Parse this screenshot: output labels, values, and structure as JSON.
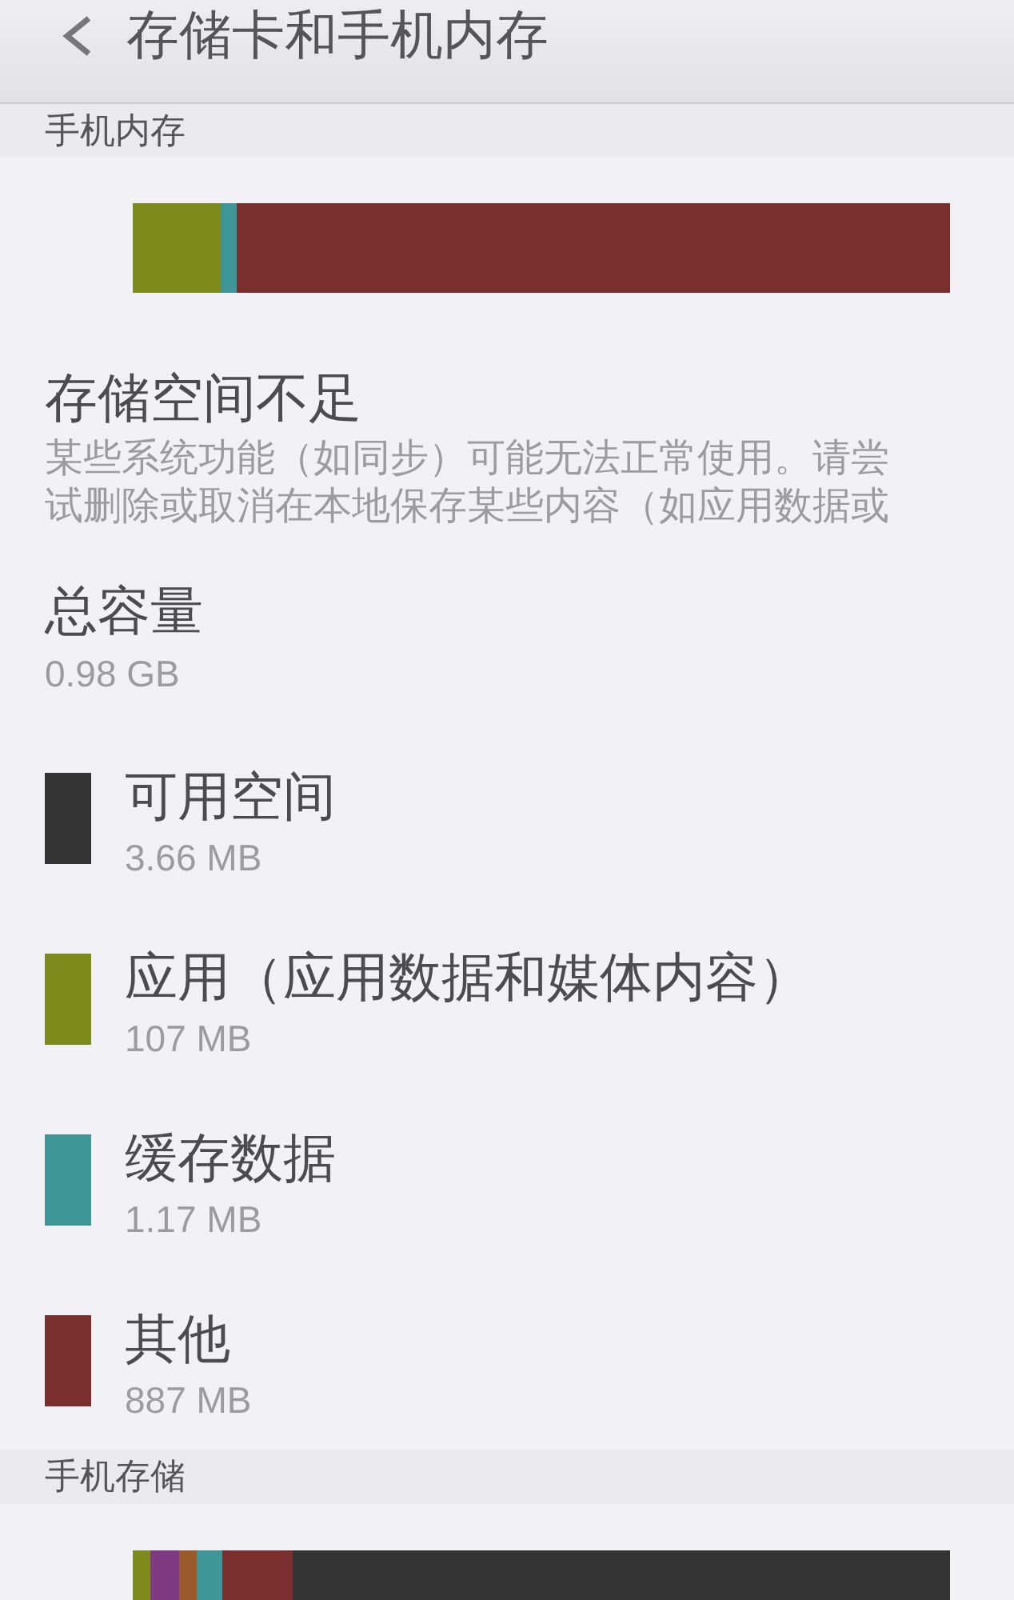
{
  "header": {
    "title": "存储卡和手机内存"
  },
  "sections": [
    {
      "title": "手机内存",
      "meter": [
        {
          "color": "#7f8a1c",
          "level": 0.107
        },
        {
          "color": "#3f9696",
          "level": 0.02
        },
        {
          "color": "#7b2e2e",
          "level": 0.873
        }
      ],
      "alert": {
        "title": "存储空间不足",
        "text": "某些系统功能（如同步）可能无法正常使用。请尝试删除或取消在本地保存某些内容（如应用数据或"
      },
      "total": {
        "label": "总容量",
        "value": "0.98 GB"
      },
      "legend": [
        {
          "label": "可用空间",
          "value": "3.66 MB",
          "color": "#333333"
        },
        {
          "label": "应用（应用数据和媒体内容）",
          "value": "107 MB",
          "color": "#7f8a1c"
        },
        {
          "label": "缓存数据",
          "value": "1.17 MB",
          "color": "#3f9696"
        },
        {
          "label": "其他",
          "value": "887 MB",
          "color": "#7b2e2e"
        }
      ]
    },
    {
      "title": "手机存储",
      "meter": [
        {
          "color": "#7f8a1c",
          "level": 0.022
        },
        {
          "color": "#7e3a80",
          "level": 0.035
        },
        {
          "color": "#9a5a2c",
          "level": 0.021
        },
        {
          "color": "#3f9696",
          "level": 0.031
        },
        {
          "color": "#7b2e2e",
          "level": 0.086
        }
      ]
    }
  ]
}
